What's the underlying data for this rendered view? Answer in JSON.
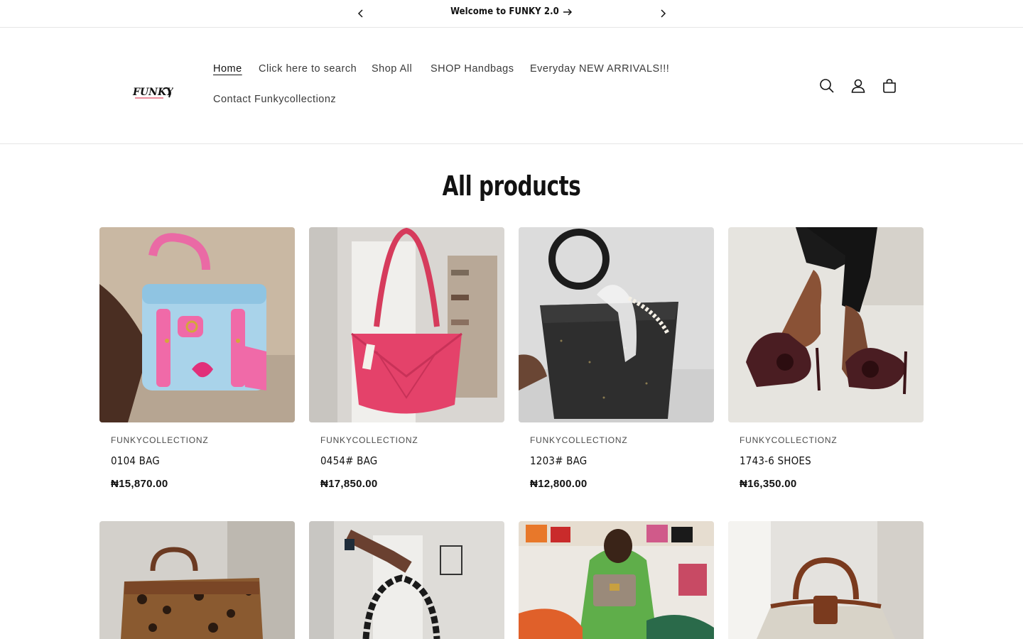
{
  "announcement": {
    "message": "Welcome to FUNKY 2.0"
  },
  "header": {
    "logo_text": "FUNKY",
    "nav": [
      {
        "label": "Home",
        "active": true
      },
      {
        "label": "Click here to search"
      },
      {
        "label": "Shop All"
      },
      {
        "label": "SHOP Handbags"
      },
      {
        "label": "Everyday NEW ARRIVALS!!!"
      },
      {
        "label": "Contact Funkycollectionz"
      }
    ],
    "icons": [
      "search-icon",
      "account-icon",
      "cart-icon"
    ]
  },
  "page": {
    "title": "All products"
  },
  "products": [
    {
      "vendor": "FUNKYCOLLECTIONZ",
      "name": "0104 BAG",
      "price": "₦15,870.00"
    },
    {
      "vendor": "FUNKYCOLLECTIONZ",
      "name": "0454# BAG",
      "price": "₦17,850.00"
    },
    {
      "vendor": "FUNKYCOLLECTIONZ",
      "name": "1203# BAG",
      "price": "₦12,800.00"
    },
    {
      "vendor": "FUNKYCOLLECTIONZ",
      "name": "1743-6 SHOES",
      "price": "₦16,350.00"
    },
    {
      "vendor": "",
      "name": "",
      "price": ""
    },
    {
      "vendor": "",
      "name": "",
      "price": ""
    },
    {
      "vendor": "",
      "name": "",
      "price": ""
    },
    {
      "vendor": "",
      "name": "",
      "price": ""
    }
  ],
  "colors": {
    "text": "#121212",
    "border": "#e6e6e6",
    "logo_accent": "#d81b3a"
  }
}
